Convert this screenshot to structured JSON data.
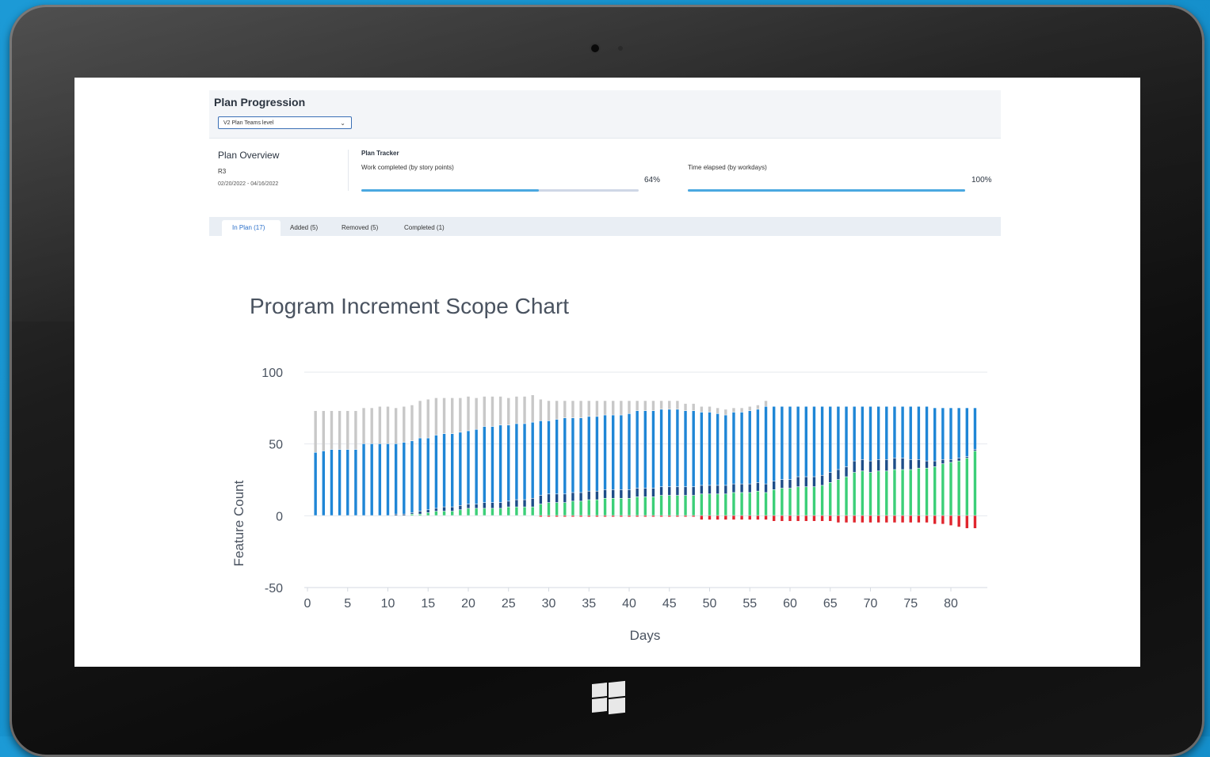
{
  "app": {
    "title": "Plan Progression",
    "select_value": "V2 Plan Teams level"
  },
  "overview": {
    "title": "Plan Overview",
    "release": "R3",
    "dates": "02/20/2022 - 04/16/2022"
  },
  "tracker": {
    "title": "Plan Tracker",
    "work_label": "Work completed (by story points)",
    "work_percent_text": "64%",
    "work_fraction": 0.64,
    "time_label": "Time elapsed (by workdays)",
    "time_percent_text": "100%",
    "time_fraction": 1.0
  },
  "tabs": [
    {
      "label": "In Plan (17)",
      "active": true
    },
    {
      "label": "Added (5)",
      "active": false
    },
    {
      "label": "Removed (5)",
      "active": false
    },
    {
      "label": "Completed (1)",
      "active": false
    }
  ],
  "colors": {
    "in_plan": "#1f86d6",
    "added": "#1d4e89",
    "completed": "#3ccf78",
    "removed": "#e0262e",
    "unplanned": "#c8c8c8",
    "progress": "#4aa8e0"
  },
  "chart_data": {
    "type": "bar",
    "stacked": true,
    "title": "Program Increment Scope Chart",
    "xlabel": "Days",
    "ylabel": "Feature Count",
    "ylim": [
      -50,
      100
    ],
    "yticks": [
      -50,
      0,
      50,
      100
    ],
    "xticks": [
      0,
      5,
      10,
      15,
      20,
      25,
      30,
      35,
      40,
      45,
      50,
      55,
      60,
      65,
      70,
      75,
      80
    ],
    "grid": true,
    "x": [
      1,
      2,
      3,
      4,
      5,
      6,
      7,
      8,
      9,
      10,
      11,
      12,
      13,
      14,
      15,
      16,
      17,
      18,
      19,
      20,
      21,
      22,
      23,
      24,
      25,
      26,
      27,
      28,
      29,
      30,
      31,
      32,
      33,
      34,
      35,
      36,
      37,
      38,
      39,
      40,
      41,
      42,
      43,
      44,
      45,
      46,
      47,
      48,
      49,
      50,
      51,
      52,
      53,
      54,
      55,
      56,
      57,
      58,
      59,
      60,
      61,
      62,
      63,
      64,
      65,
      66,
      67,
      68,
      69,
      70,
      71,
      72,
      73,
      74,
      75,
      76,
      77,
      78,
      79,
      80,
      81,
      82,
      83
    ],
    "series": [
      {
        "key": "completed",
        "values": [
          0,
          0,
          0,
          0,
          0,
          0,
          0,
          0,
          0,
          0,
          0,
          0,
          1,
          1,
          2,
          3,
          3,
          3,
          4,
          5,
          5,
          5,
          5,
          5,
          6,
          6,
          6,
          6,
          8,
          9,
          9,
          9,
          10,
          10,
          11,
          11,
          12,
          12,
          12,
          12,
          13,
          13,
          13,
          14,
          14,
          14,
          14,
          14,
          15,
          15,
          15,
          15,
          16,
          16,
          16,
          17,
          16,
          18,
          19,
          19,
          20,
          20,
          20,
          21,
          23,
          25,
          27,
          30,
          31,
          30,
          31,
          31,
          32,
          32,
          32,
          33,
          33,
          34,
          36,
          37,
          38,
          40,
          45
        ]
      },
      {
        "key": "added",
        "values": [
          0,
          0,
          0,
          0,
          0,
          0,
          0,
          0,
          0,
          0,
          1,
          1,
          1,
          2,
          2,
          2,
          3,
          3,
          3,
          3,
          3,
          4,
          4,
          4,
          4,
          5,
          5,
          6,
          6,
          6,
          6,
          6,
          6,
          6,
          6,
          6,
          6,
          6,
          6,
          6,
          6,
          6,
          6,
          6,
          6,
          6,
          6,
          6,
          6,
          6,
          6,
          6,
          6,
          6,
          6,
          6,
          6,
          6,
          6,
          6,
          7,
          7,
          7,
          7,
          7,
          7,
          7,
          8,
          8,
          8,
          8,
          8,
          8,
          8,
          7,
          6,
          5,
          4,
          3,
          2,
          2,
          1,
          1
        ]
      },
      {
        "key": "in_plan",
        "values": [
          44,
          45,
          46,
          46,
          46,
          46,
          50,
          50,
          50,
          50,
          49,
          50,
          50,
          51,
          50,
          51,
          51,
          51,
          51,
          51,
          52,
          53,
          53,
          54,
          53,
          53,
          53,
          53,
          52,
          51,
          52,
          53,
          52,
          52,
          52,
          52,
          52,
          52,
          52,
          53,
          54,
          54,
          54,
          54,
          54,
          54,
          53,
          53,
          51,
          51,
          50,
          49,
          50,
          50,
          51,
          51,
          54,
          52,
          51,
          51,
          49,
          49,
          49,
          48,
          46,
          44,
          42,
          38,
          37,
          38,
          37,
          37,
          36,
          36,
          37,
          37,
          38,
          37,
          36,
          36,
          35,
          34,
          29
        ]
      },
      {
        "key": "unplanned",
        "values": [
          29,
          28,
          27,
          27,
          27,
          27,
          25,
          25,
          26,
          26,
          25,
          25,
          25,
          26,
          27,
          26,
          25,
          25,
          24,
          24,
          22,
          21,
          21,
          20,
          19,
          19,
          19,
          19,
          15,
          14,
          13,
          12,
          12,
          12,
          11,
          11,
          10,
          10,
          10,
          9,
          7,
          7,
          7,
          6,
          6,
          6,
          5,
          5,
          4,
          4,
          4,
          4,
          3,
          3,
          3,
          3,
          4,
          0,
          0,
          0,
          0,
          0,
          0,
          0,
          0,
          0,
          0,
          0,
          0,
          0,
          0,
          0,
          0,
          0,
          0,
          0,
          0,
          0,
          0,
          0,
          0,
          0,
          0
        ]
      },
      {
        "key": "removed",
        "values": [
          0,
          0,
          0,
          0,
          0,
          0,
          0,
          0,
          0,
          0,
          0,
          0,
          0,
          0,
          0,
          0,
          0,
          0,
          0,
          0,
          0,
          0,
          0,
          0,
          0,
          0,
          0,
          0,
          -1,
          -1,
          -1,
          -1,
          -1,
          -1,
          -1,
          -1,
          -1,
          -1,
          -1,
          -1,
          -1,
          -1,
          -1,
          -1,
          -1,
          -1,
          -1,
          -1,
          -3,
          -3,
          -3,
          -3,
          -3,
          -3,
          -3,
          -3,
          -3,
          -4,
          -4,
          -4,
          -4,
          -4,
          -4,
          -4,
          -4,
          -5,
          -5,
          -5,
          -5,
          -5,
          -5,
          -5,
          -5,
          -5,
          -5,
          -5,
          -5,
          -6,
          -6,
          -7,
          -8,
          -9,
          -9
        ]
      }
    ]
  }
}
